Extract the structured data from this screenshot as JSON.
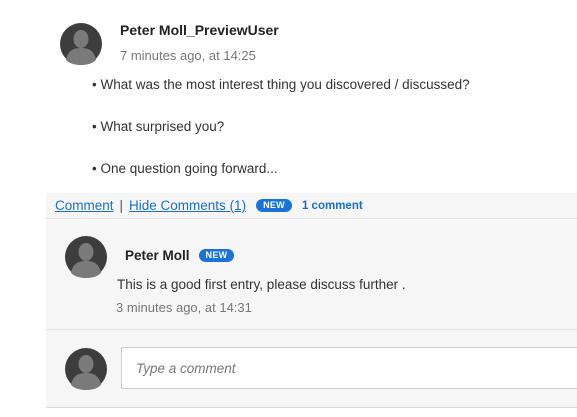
{
  "post": {
    "author": "Peter Moll_PreviewUser",
    "time": "7 minutes ago, at 14:25",
    "avatar_icon": "user-silhouette-icon",
    "bullets": [
      "• What was the most interest thing you discovered / discussed?",
      "• What surprised you?",
      "• One question going forward..."
    ]
  },
  "comment_bar": {
    "comment_link": "Comment",
    "separator": "|",
    "hide_link": "Hide Comments (1)",
    "new_badge": "NEW",
    "count": "1 comment"
  },
  "comments": [
    {
      "author": "Peter Moll",
      "badge": "NEW",
      "text": "This is a good first entry, please discuss further .",
      "time": "3 minutes ago, at 14:31",
      "avatar_icon": "user-silhouette-icon"
    }
  ],
  "comment_input": {
    "placeholder": "Type a comment",
    "value": "",
    "avatar_icon": "user-silhouette-icon"
  },
  "colors": {
    "link": "#1a6fc4",
    "badge": "#1a73d9",
    "panel": "#f6f6f6",
    "avatar": "#3d3d3d"
  }
}
